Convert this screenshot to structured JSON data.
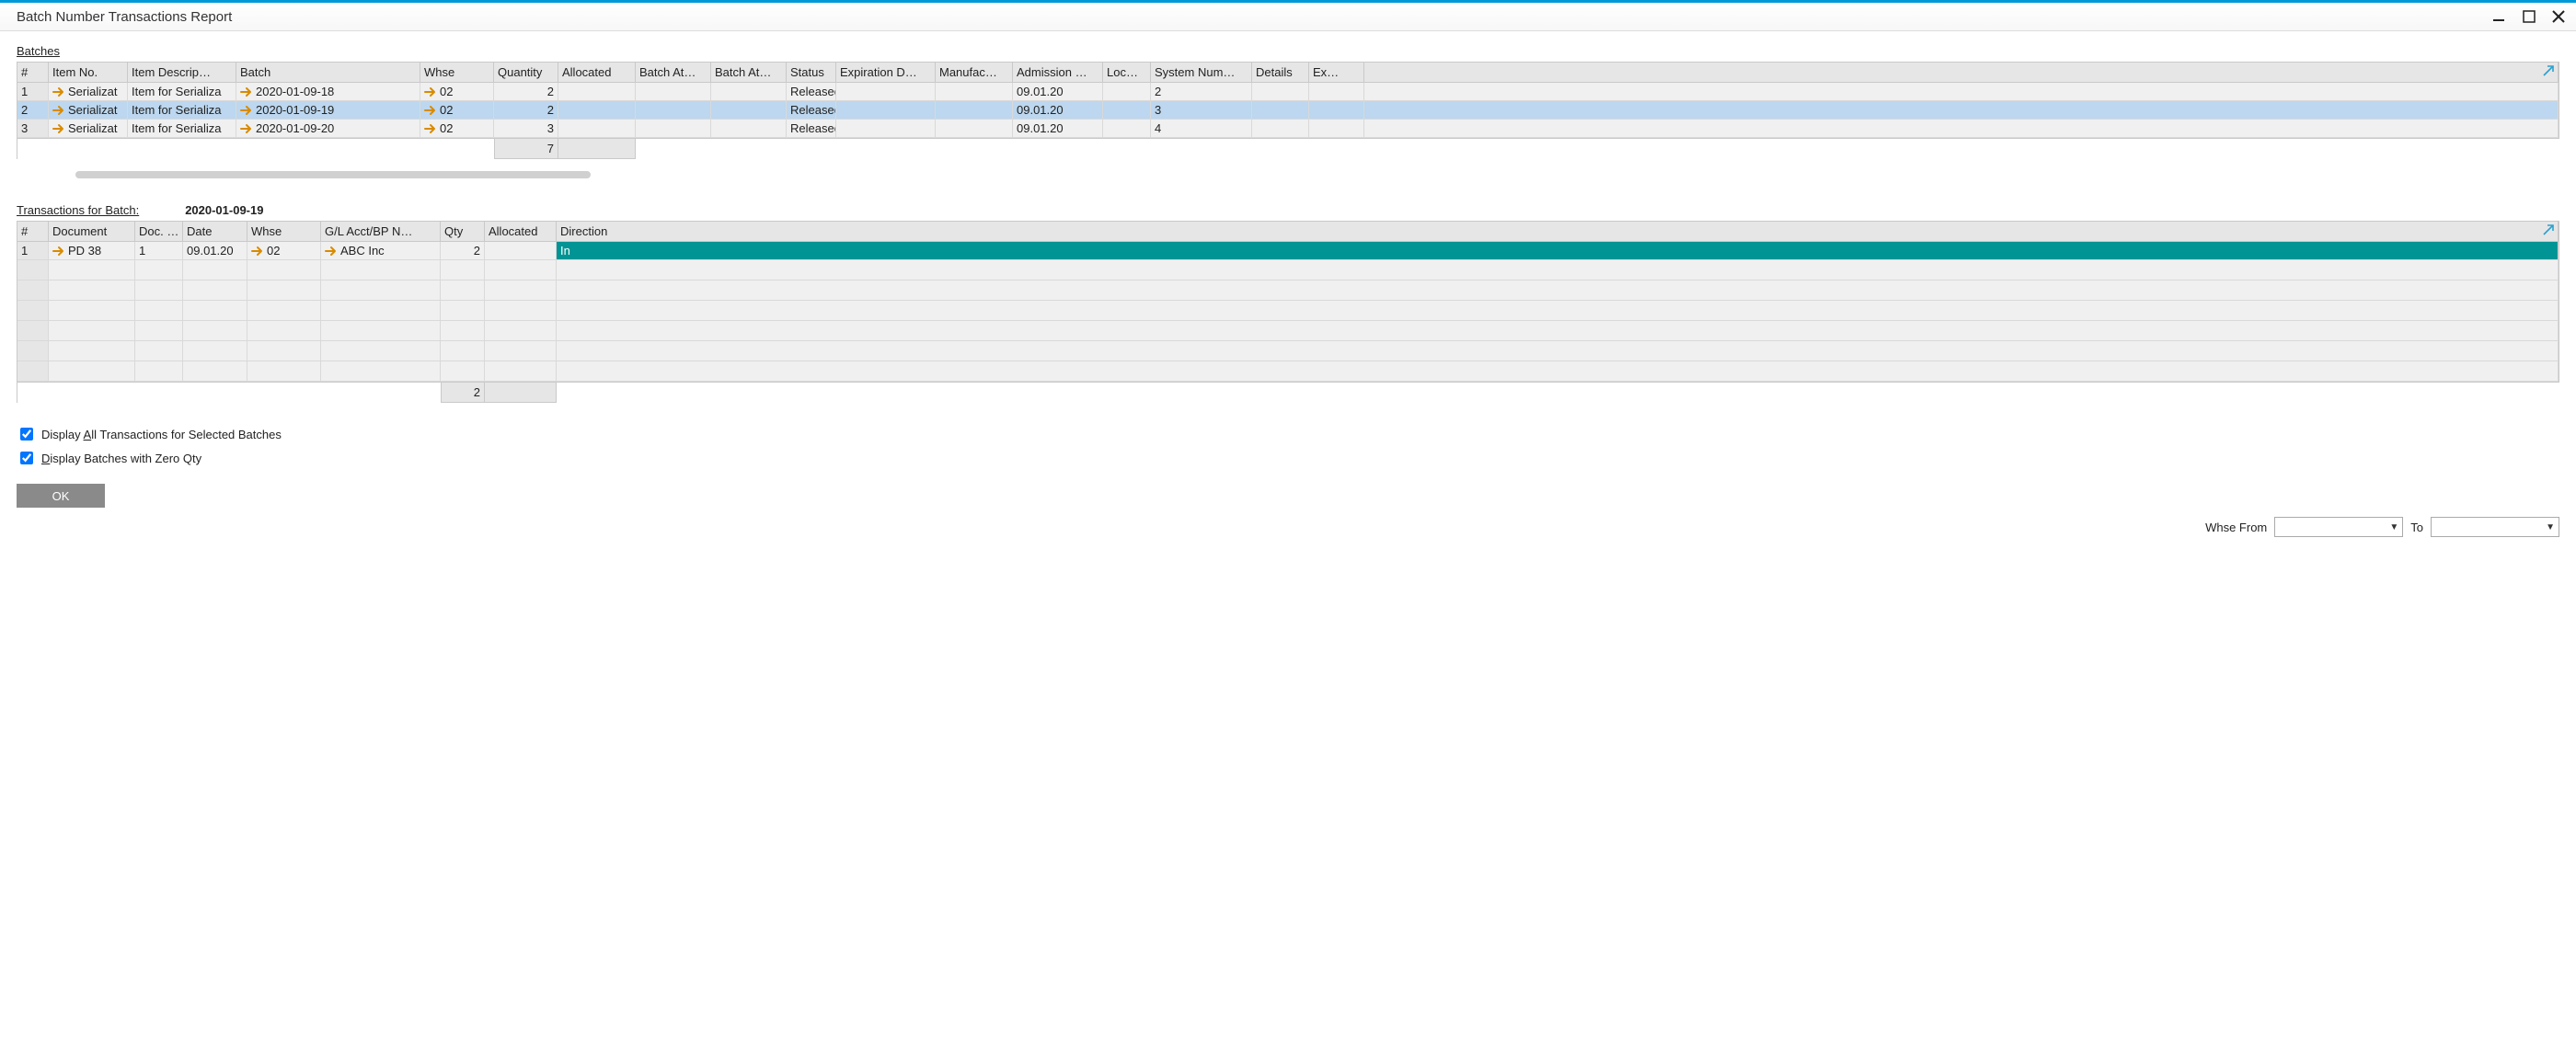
{
  "window": {
    "title": "Batch Number Transactions Report"
  },
  "batches": {
    "label": "Batches",
    "columns": [
      "#",
      "Item No.",
      "Item Descrip…",
      "Batch",
      "Whse",
      "Quantity",
      "Allocated",
      "Batch At…",
      "Batch At…",
      "Status",
      "Expiration D…",
      "Manufac…",
      "Admission …",
      "Loc…",
      "System Num…",
      "Details",
      "Ex…",
      ""
    ],
    "rows": [
      {
        "n": "1",
        "item": "Serializat",
        "desc": "Item for Serializa",
        "batch": "2020-01-09-18",
        "whse": "02",
        "qty": "2",
        "status": "Released",
        "admission": "09.01.20",
        "sysnum": "2"
      },
      {
        "n": "2",
        "item": "Serializat",
        "desc": "Item for Serializa",
        "batch": "2020-01-09-19",
        "whse": "02",
        "qty": "2",
        "status": "Released",
        "admission": "09.01.20",
        "sysnum": "3",
        "selected": true
      },
      {
        "n": "3",
        "item": "Serializat",
        "desc": "Item for Serializa",
        "batch": "2020-01-09-20",
        "whse": "02",
        "qty": "3",
        "status": "Released",
        "admission": "09.01.20",
        "sysnum": "4"
      }
    ],
    "totals": {
      "qty": "7"
    }
  },
  "transactions": {
    "label": "Transactions for Batch:",
    "batch_value": "2020-01-09-19",
    "columns": [
      "#",
      "Document",
      "Doc. …",
      "Date",
      "Whse",
      "G/L Acct/BP N…",
      "Qty",
      "Allocated",
      "Direction"
    ],
    "rows": [
      {
        "n": "1",
        "doc": "PD 38",
        "docno": "1",
        "date": "09.01.20",
        "whse": "02",
        "bp": "ABC Inc",
        "qty": "2",
        "direction": "In"
      }
    ],
    "totals": {
      "qty": "2"
    }
  },
  "options": {
    "all_trans_label_pre": "Display ",
    "all_trans_label_u": "A",
    "all_trans_label_post": "ll Transactions for Selected Batches",
    "zero_qty_label_pre": "",
    "zero_qty_label_u": "D",
    "zero_qty_label_post": "isplay Batches with Zero Qty",
    "all_trans_checked": true,
    "zero_qty_checked": true
  },
  "whse": {
    "from_label": "Whse From",
    "to_label": "To"
  },
  "buttons": {
    "ok": "OK"
  }
}
